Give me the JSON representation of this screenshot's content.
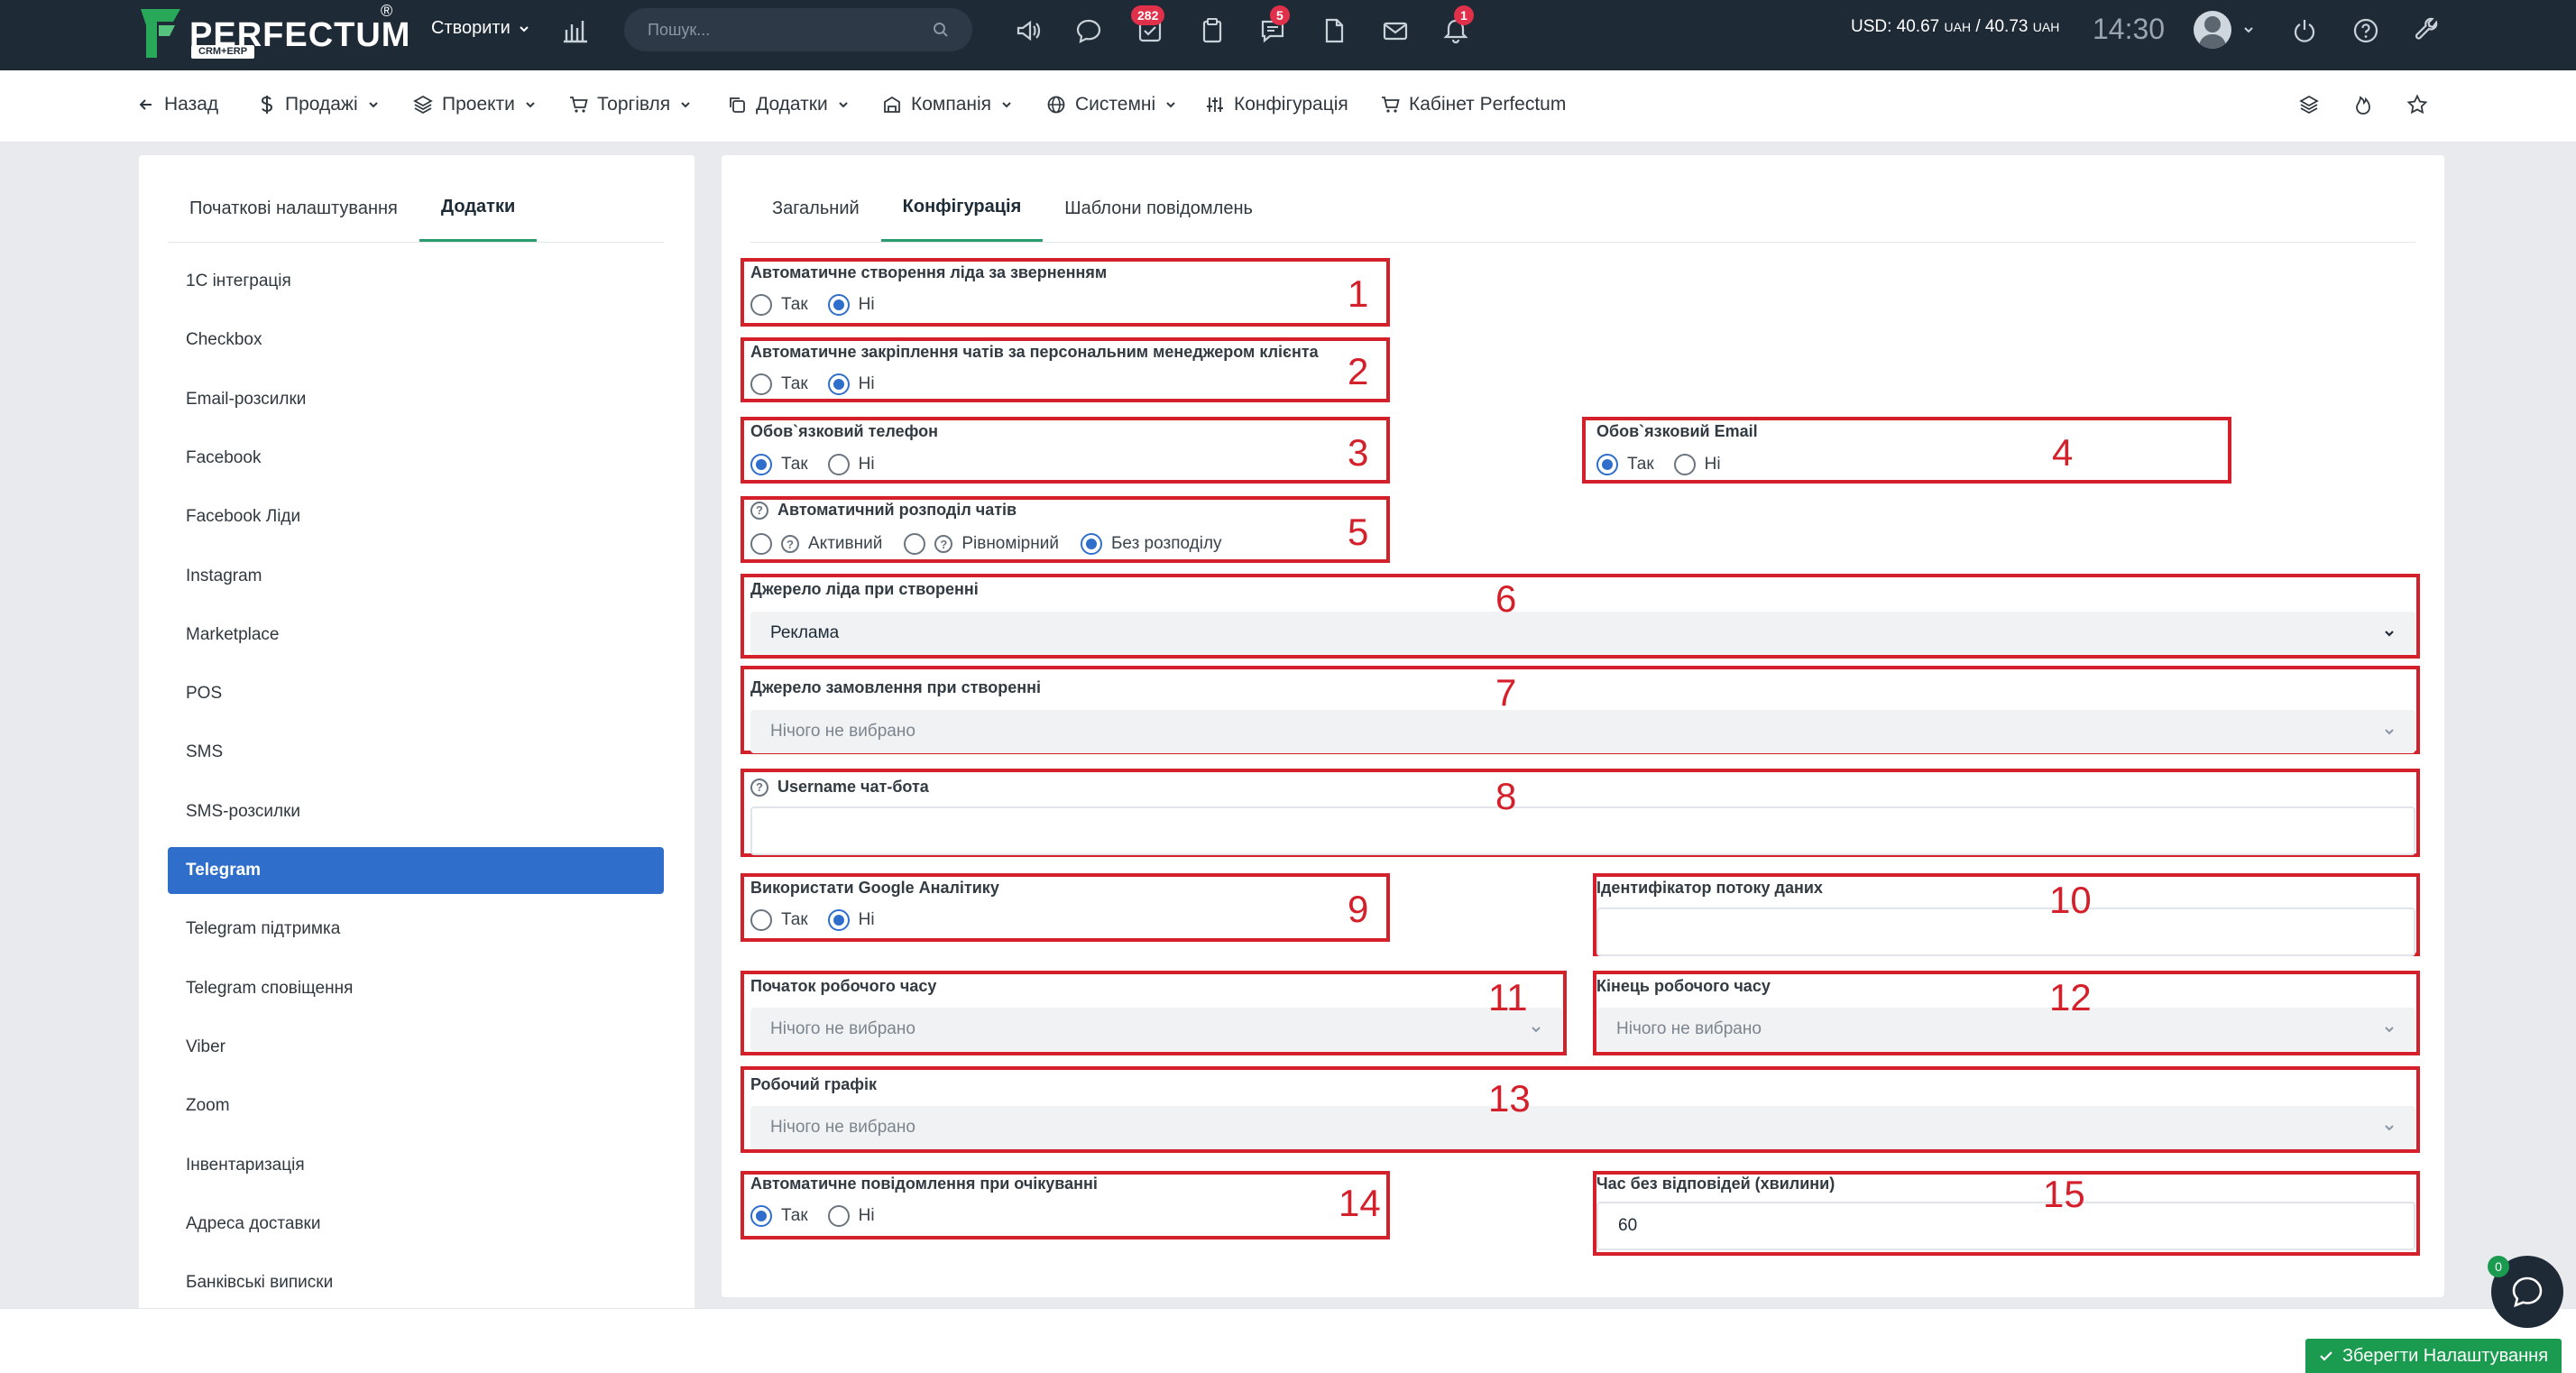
{
  "topbar": {
    "logo_text": "PERFECTUM",
    "logo_sub": "CRM+ERP",
    "logo_reg": "®",
    "create_label": "Створити",
    "search_placeholder": "Пошук...",
    "badges": {
      "tasks": "282",
      "chats": "5",
      "notifications": "1"
    },
    "currency_usd_label": "USD: 40.67",
    "currency_uah1": "UAH",
    "currency_sep": " / 40.73 ",
    "currency_uah2": "UAH",
    "time": "14:30",
    "icons": [
      "chart-icon",
      "megaphone-icon",
      "chat-bubble-icon",
      "task-check-icon",
      "clipboard-icon",
      "chat-lines-icon",
      "file-icon",
      "mail-icon",
      "bell-icon",
      "avatar",
      "power-icon",
      "help-icon",
      "wrench-icon"
    ]
  },
  "nav": {
    "back": "Назад",
    "sales": "Продажі",
    "projects": "Проекти",
    "trade": "Торгівля",
    "addons": "Додатки",
    "company": "Компанія",
    "system": "Системні",
    "config": "Конфігурація",
    "cabinet": "Кабінет Perfectum"
  },
  "sidebar": {
    "tabs": [
      "Початкові налаштування",
      "Додатки"
    ],
    "active_tab": "Додатки",
    "items": [
      {
        "label": "1С інтеграція"
      },
      {
        "label": "Checkbox"
      },
      {
        "label": "Email-розсилки"
      },
      {
        "label": "Facebook"
      },
      {
        "label": "Facebook Ліди"
      },
      {
        "label": "Instagram"
      },
      {
        "label": "Marketplace"
      },
      {
        "label": "POS"
      },
      {
        "label": "SMS"
      },
      {
        "label": "SMS-розсилки"
      },
      {
        "label": "Telegram"
      },
      {
        "label": "Telegram підтримка"
      },
      {
        "label": "Telegram сповіщення"
      },
      {
        "label": "Viber"
      },
      {
        "label": "Zoom"
      },
      {
        "label": "Інвентаризація"
      },
      {
        "label": "Адреса доставки"
      },
      {
        "label": "Банківські виписки"
      }
    ],
    "active_item": "Telegram"
  },
  "main": {
    "tabs": [
      "Загальний",
      "Конфігурація",
      "Шаблони повідомлень"
    ],
    "active_tab": "Конфігурація",
    "yes": "Так",
    "no": "Ні",
    "f1": {
      "label": "Автоматичне створення ліда за зверненням",
      "value": "Ні",
      "num": "1"
    },
    "f2": {
      "label": "Автоматичне закріплення чатів за персональним менеджером клієнта",
      "value": "Ні",
      "num": "2"
    },
    "f3": {
      "label": "Обов`язковий телефон",
      "value": "Так",
      "num": "3"
    },
    "f4": {
      "label": "Обов`язковий Email",
      "value": "Так",
      "num": "4"
    },
    "f5": {
      "label": "Автоматичний розподіл чатів",
      "options": [
        "Активний",
        "Рівномірний",
        "Без розподілу"
      ],
      "value": "Без розподілу",
      "num": "5"
    },
    "f6": {
      "label": "Джерело ліда при створенні",
      "value": "Реклама",
      "num": "6"
    },
    "f7": {
      "label": "Джерело замовлення при створенні",
      "placeholder": "Нічого не вибрано",
      "num": "7"
    },
    "f8": {
      "label": "Username чат-бота",
      "value": "",
      "num": "8"
    },
    "f9": {
      "label": "Використати Google Аналітику",
      "value": "Ні",
      "num": "9"
    },
    "f10": {
      "label": "Ідентифікатор потоку даних",
      "value": "",
      "num": "10"
    },
    "f11": {
      "label": "Початок робочого часу",
      "placeholder": "Нічого не вибрано",
      "num": "11"
    },
    "f12": {
      "label": "Кінець робочого часу",
      "placeholder": "Нічого не вибрано",
      "num": "12"
    },
    "f13": {
      "label": "Робочий графік",
      "placeholder": "Нічого не вибрано",
      "num": "13"
    },
    "f14": {
      "label": "Автоматичне повідомлення при очікуванні",
      "value": "Так",
      "num": "14"
    },
    "f15": {
      "label": "Час без відповідей (хвилини)",
      "value": "60",
      "num": "15"
    }
  },
  "footer": {
    "save_label": "Зберегти Налаштування",
    "chat_badge": "0"
  },
  "colors": {
    "topbar_bg": "#1f2a37",
    "accent_blue": "#2f6fcb",
    "tab_underline": "#2a9d6f",
    "annotation_red": "#d4202b",
    "save_green": "#1b9b4f",
    "badge_red": "#e0304a"
  }
}
